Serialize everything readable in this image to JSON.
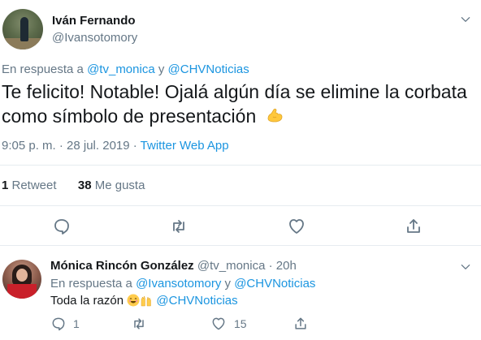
{
  "main_tweet": {
    "author_name": "Iván Fernando",
    "author_handle": "@Ivansotomory",
    "reply_prefix": "En respuesta a ",
    "reply_user1": "@tv_monica",
    "reply_join": " y ",
    "reply_user2": "@CHVNoticias",
    "text": "Te felicito! Notable! Ojalá algún día se elimine la corbata como símbolo de presentación",
    "emoji": "flexed-biceps",
    "time": "9:05 p. m. · 28 jul. 2019 · ",
    "source": "Twitter Web App",
    "retweets_count": "1",
    "retweets_label": " Retweet",
    "likes_count": "38",
    "likes_label": " Me gusta"
  },
  "reply_tweet": {
    "author_name": "Mónica Rincón González",
    "author_handle": "@tv_monica",
    "separator": " · ",
    "time": "20h",
    "reply_prefix": "En respuesta a ",
    "reply_user1": "@Ivansotomory",
    "reply_join": " y ",
    "reply_user2": "@CHVNoticias",
    "text": "Toda la razón ",
    "mention": "@CHVNoticias",
    "emojis": [
      "smiling-face",
      "raising-hands"
    ],
    "reply_count": "1",
    "like_count": "15"
  },
  "colors": {
    "link": "#1b95e0",
    "secondary_text": "#657786",
    "divider": "#e6ecf0"
  },
  "icons": [
    "chevron-down-icon",
    "reply-icon",
    "retweet-icon",
    "like-icon",
    "share-icon"
  ]
}
